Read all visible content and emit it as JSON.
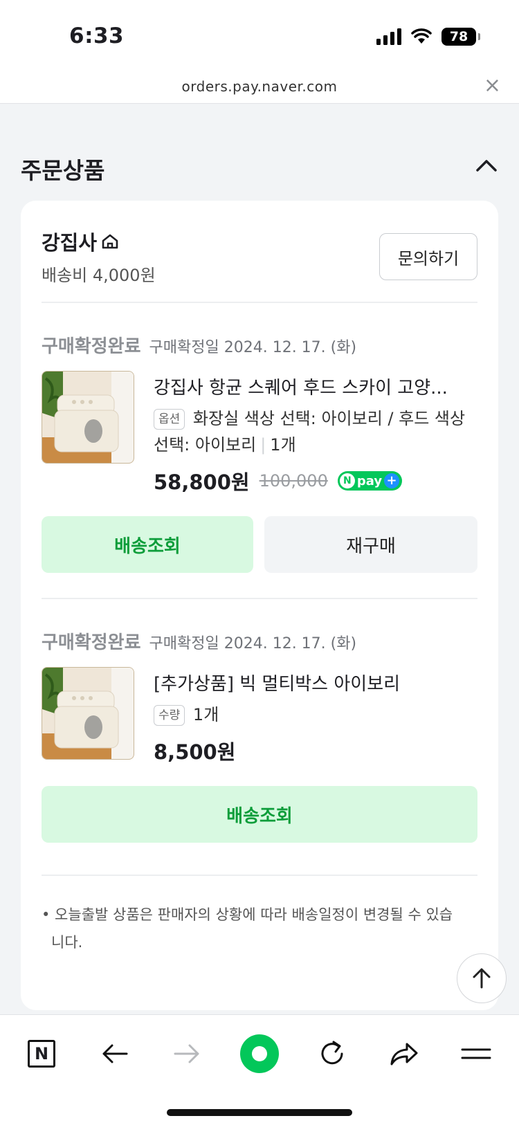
{
  "status_bar": {
    "time": "6:33",
    "battery": "78"
  },
  "browser": {
    "url": "orders.pay.naver.com",
    "close": "×"
  },
  "section": {
    "title": "주문상품"
  },
  "seller": {
    "name": "강집사",
    "shipping_fee": "배송비 4,000원",
    "inquiry_label": "문의하기"
  },
  "orders": [
    {
      "status": "구매확정완료",
      "confirm_date": "구매확정일 2024. 12. 17. (화)",
      "product_name": "강집사 항균 스퀘어 후드 스카이 고양...",
      "option_badge": "옵션",
      "option_text": "화장실 색상 선택: 아이보리 / 후드 색상 선택: 아이보리",
      "quantity": "1개",
      "price": "58,800원",
      "original_price": "100,000",
      "npay_label": "pay",
      "track_label": "배송조회",
      "rebuy_label": "재구매"
    },
    {
      "status": "구매확정완료",
      "confirm_date": "구매확정일 2024. 12. 17. (화)",
      "product_name": "[추가상품] 빅 멀티박스 아이보리",
      "option_badge": "수량",
      "quantity": "1개",
      "price": "8,500원",
      "track_label": "배송조회"
    }
  ],
  "notice": "• 오늘출발 상품은 판매자의 상황에 따라 배송일정이 변경될 수 있습니다.",
  "toolbar": {
    "naver_label": "N"
  },
  "colors": {
    "accent_green": "#03c75a",
    "button_green_bg": "#d8f9e1",
    "button_green_text": "#0d9d3a"
  }
}
